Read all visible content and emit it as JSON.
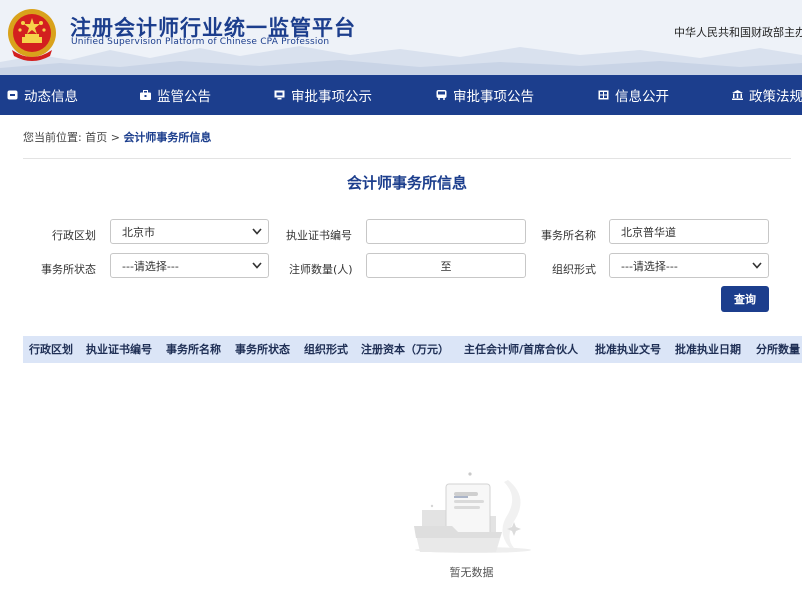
{
  "header": {
    "title": "注册会计师行业统一监管平台",
    "subtitle": "Unified Supervision Platform of Chinese CPA Profession",
    "sponsor": "中华人民共和国财政部主办",
    "brand_color": "#1c3e8d",
    "emblem": "national-emblem"
  },
  "nav": {
    "items": [
      {
        "label": "动态信息",
        "icon": "square-icon"
      },
      {
        "label": "监管公告",
        "icon": "briefcase-icon"
      },
      {
        "label": "审批事项公示",
        "icon": "monitor-icon"
      },
      {
        "label": "审批事项公告",
        "icon": "bus-icon"
      },
      {
        "label": "信息公开",
        "icon": "grid-icon"
      },
      {
        "label": "政策法规",
        "icon": "bank-icon"
      }
    ]
  },
  "breadcrumb": {
    "prefix": "您当前位置:",
    "home": "首页",
    "separator": ">",
    "current": "会计师事务所信息"
  },
  "page": {
    "title": "会计师事务所信息"
  },
  "form": {
    "region_label": "行政区划",
    "region_value": "北京市",
    "license_label": "执业证书编号",
    "license_value": "",
    "firm_name_label": "事务所名称",
    "firm_name_value": "北京普华道",
    "status_label": "事务所状态",
    "status_value": "---请选择---",
    "cpa_count_label": "注师数量(人)",
    "cpa_count_from": "",
    "cpa_count_sep": "至",
    "cpa_count_to": "",
    "org_form_label": "组织形式",
    "org_form_value": "---请选择---",
    "query_button": "查询"
  },
  "table": {
    "header_bg": "#dbe5f7",
    "columns": [
      "行政区划",
      "执业证书编号",
      "事务所名称",
      "事务所状态",
      "组织形式",
      "注册资本（万元）",
      "主任会计师/首席合伙人",
      "批准执业文号",
      "批准执业日期",
      "分所数量"
    ],
    "rows": []
  },
  "empty_state": {
    "text": "暂无数据",
    "icon": "empty-folder-icon"
  }
}
